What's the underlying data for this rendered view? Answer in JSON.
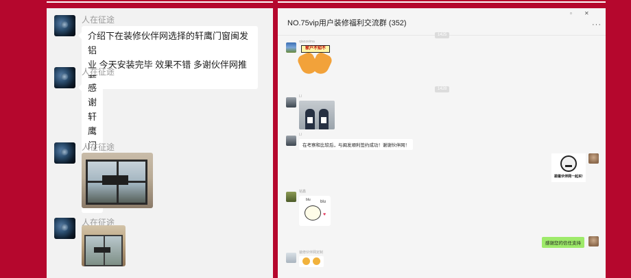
{
  "left_chat": {
    "messages": [
      {
        "sender": "人在征途",
        "lines": [
          "介绍下在装修伙伴网选择的轩鹰门窗闽发铝",
          "业 今天安装完毕 效果不错 多谢伙伴网推荐"
        ]
      },
      {
        "sender": "人在征途",
        "text": "感谢轩鹰门窗的配合"
      },
      {
        "sender": "人在征途",
        "image": "window-photo"
      },
      {
        "sender": "人在征途",
        "image": "window-photo"
      }
    ]
  },
  "group_chat": {
    "title": "NO.75vip用户装修福利交流群 (352)",
    "window_controls": {
      "minimize": "▫",
      "close": "✕"
    },
    "more_icon": "···",
    "timestamps": [
      "1425",
      "1428"
    ],
    "messages": [
      {
        "sender": "qiaozeima",
        "type": "sticker",
        "sticker_text": "家户不知不"
      },
      {
        "sender": "Ll",
        "type": "image"
      },
      {
        "sender": "Ll",
        "type": "text",
        "text": "在考察和比较后，与闽发顺利签约成功！谢谢伙伴网！"
      },
      {
        "sender": "self",
        "type": "sticker",
        "sticker_text": "跟着伙伴网一起买!"
      },
      {
        "sender": "铭鑫",
        "type": "sticker",
        "sticker_text": "blu",
        "sticker_text2": "blu"
      },
      {
        "sender": "self",
        "type": "text",
        "text": "感谢您的信任支持"
      },
      {
        "sender": "装修伙伴网定制",
        "type": "sticker"
      }
    ]
  }
}
